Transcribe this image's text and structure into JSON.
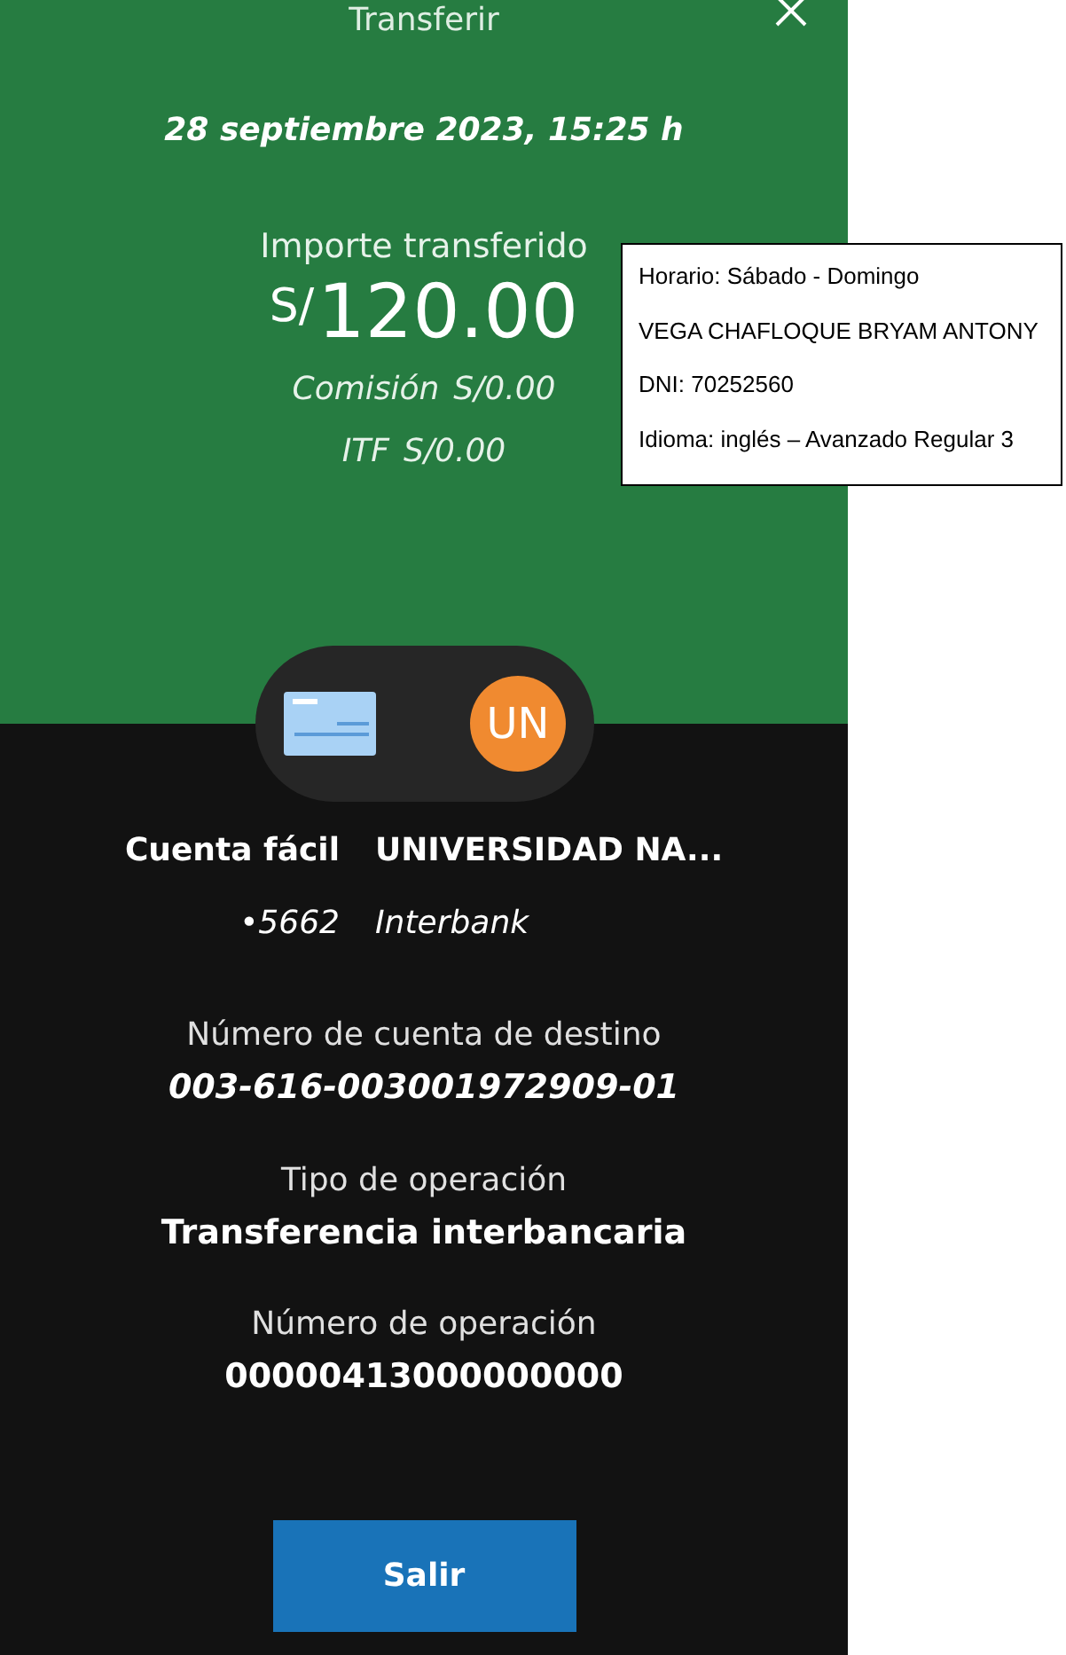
{
  "header": {
    "title": "Transferir"
  },
  "summary": {
    "date": "28 septiembre 2023, 15:25 h",
    "amount_label": "Importe transferido",
    "currency": "S/",
    "amount": "120.00",
    "fees": [
      {
        "label": "Comisión",
        "value": "S/0.00"
      },
      {
        "label": "ITF",
        "value": "S/0.00"
      }
    ]
  },
  "accounts": {
    "origin": {
      "name": "Cuenta fácil",
      "number": "•5662"
    },
    "destination": {
      "initials": "UN",
      "name": "UNIVERSIDAD NA...",
      "bank": "Interbank"
    }
  },
  "details": [
    {
      "label": "Número de cuenta de destino",
      "value": "003-616-003001972909-01",
      "italic": true
    },
    {
      "label": "Tipo de operación",
      "value": "Transferencia interbancaria",
      "italic": false
    },
    {
      "label": "Número de operación",
      "value": "00000413000000000",
      "italic": false
    }
  ],
  "button": "Salir",
  "note": [
    "Horario: Sábado - Domingo",
    "VEGA CHAFLOQUE BRYAM ANTONY",
    "DNI: 70252560",
    "Idioma: inglés – Avanzado Regular 3"
  ]
}
